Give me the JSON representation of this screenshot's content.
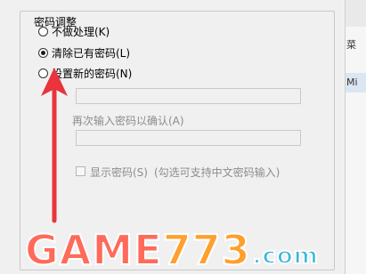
{
  "group": {
    "title": "密码调整",
    "options": [
      {
        "label": "不做处理(K)",
        "checked": false
      },
      {
        "label": "清除已有密码(L)",
        "checked": true
      },
      {
        "label": "设置新的密码(N)",
        "checked": false
      }
    ],
    "confirm_label": "再次输入密码以确认(A)",
    "show_password_label": "显示密码(S)",
    "hint": "(勾选可支持中文密码输入)"
  },
  "right_strip": {
    "text1": "菜",
    "text2": "Mi"
  },
  "watermark": {
    "part1": "GAME",
    "part2": "773",
    "part3": ".com"
  },
  "colors": {
    "arrow": "#e8343c",
    "watermark_game": "#ff6a5a",
    "watermark_773": "#ff9f2e",
    "watermark_com": "#35b8d8"
  }
}
